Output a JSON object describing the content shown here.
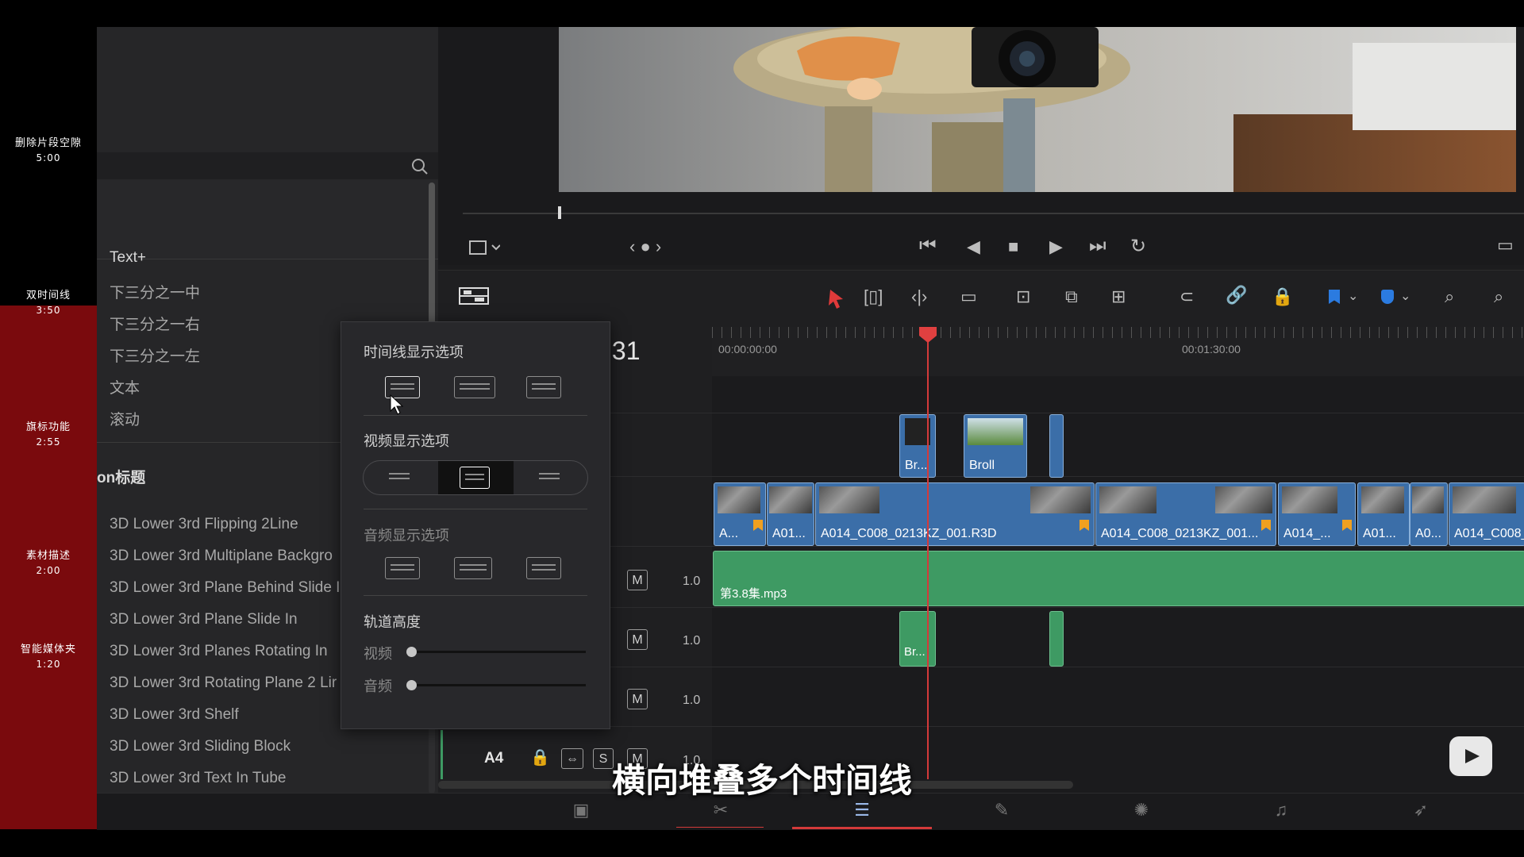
{
  "chapters": [
    {
      "title": "删除片段空隙",
      "time": "5:00"
    },
    {
      "title": "双时间线",
      "time": "3:50"
    },
    {
      "title": "旗标功能",
      "time": "2:55"
    },
    {
      "title": "素材描述",
      "time": "2:00"
    },
    {
      "title": "智能媒体夹",
      "time": "1:20"
    }
  ],
  "effects": {
    "items_text": [
      "Text+",
      "下三分之一中",
      "下三分之一右",
      "下三分之一左",
      "文本",
      "滚动"
    ],
    "section_header": "on标题",
    "items_3d": [
      "3D Lower 3rd Flipping 2Line",
      "3D Lower 3rd Multiplane Backgro",
      "3D Lower 3rd Plane Behind Slide I",
      "3D Lower 3rd Plane Slide In",
      "3D Lower 3rd Planes Rotating In",
      "3D Lower 3rd Rotating Plane 2 Lir",
      "3D Lower 3rd Shelf",
      "3D Lower 3rd Sliding Block",
      "3D Lower 3rd Text In Tube"
    ]
  },
  "popup": {
    "timeline_display": "时间线显示选项",
    "video_display": "视频显示选项",
    "audio_display": "音频显示选项",
    "track_height": "轨道高度",
    "video_label": "视频",
    "audio_label": "音频",
    "video_height": 0,
    "audio_height": 0,
    "selected_video_option": 2
  },
  "timeline": {
    "timecode_partial": ":31",
    "ruler_left": "00:00:00:00",
    "ruler_right": "00:01:30:00",
    "track_a4": "A4",
    "mute_label": "M",
    "solo_label": "S",
    "gain": "1.0",
    "audio_clip": "第3.8集.mp3",
    "v2_clips": [
      "Br...",
      "Broll"
    ],
    "v1_clips": [
      "A...",
      "A01...",
      "A014_C008_0213KZ_001.R3D",
      "A014_C008_0213KZ_001...",
      "A014_...",
      "A01...",
      "A0...",
      "A014_C008_"
    ],
    "a2_clip": "Br..."
  },
  "subtitle": "横向堆叠多个时间线",
  "colors": {
    "accent_red": "#d43a3a",
    "video_clip": "#3b6ea8",
    "audio_clip": "#3e9a63",
    "flag": "#f0a020"
  }
}
